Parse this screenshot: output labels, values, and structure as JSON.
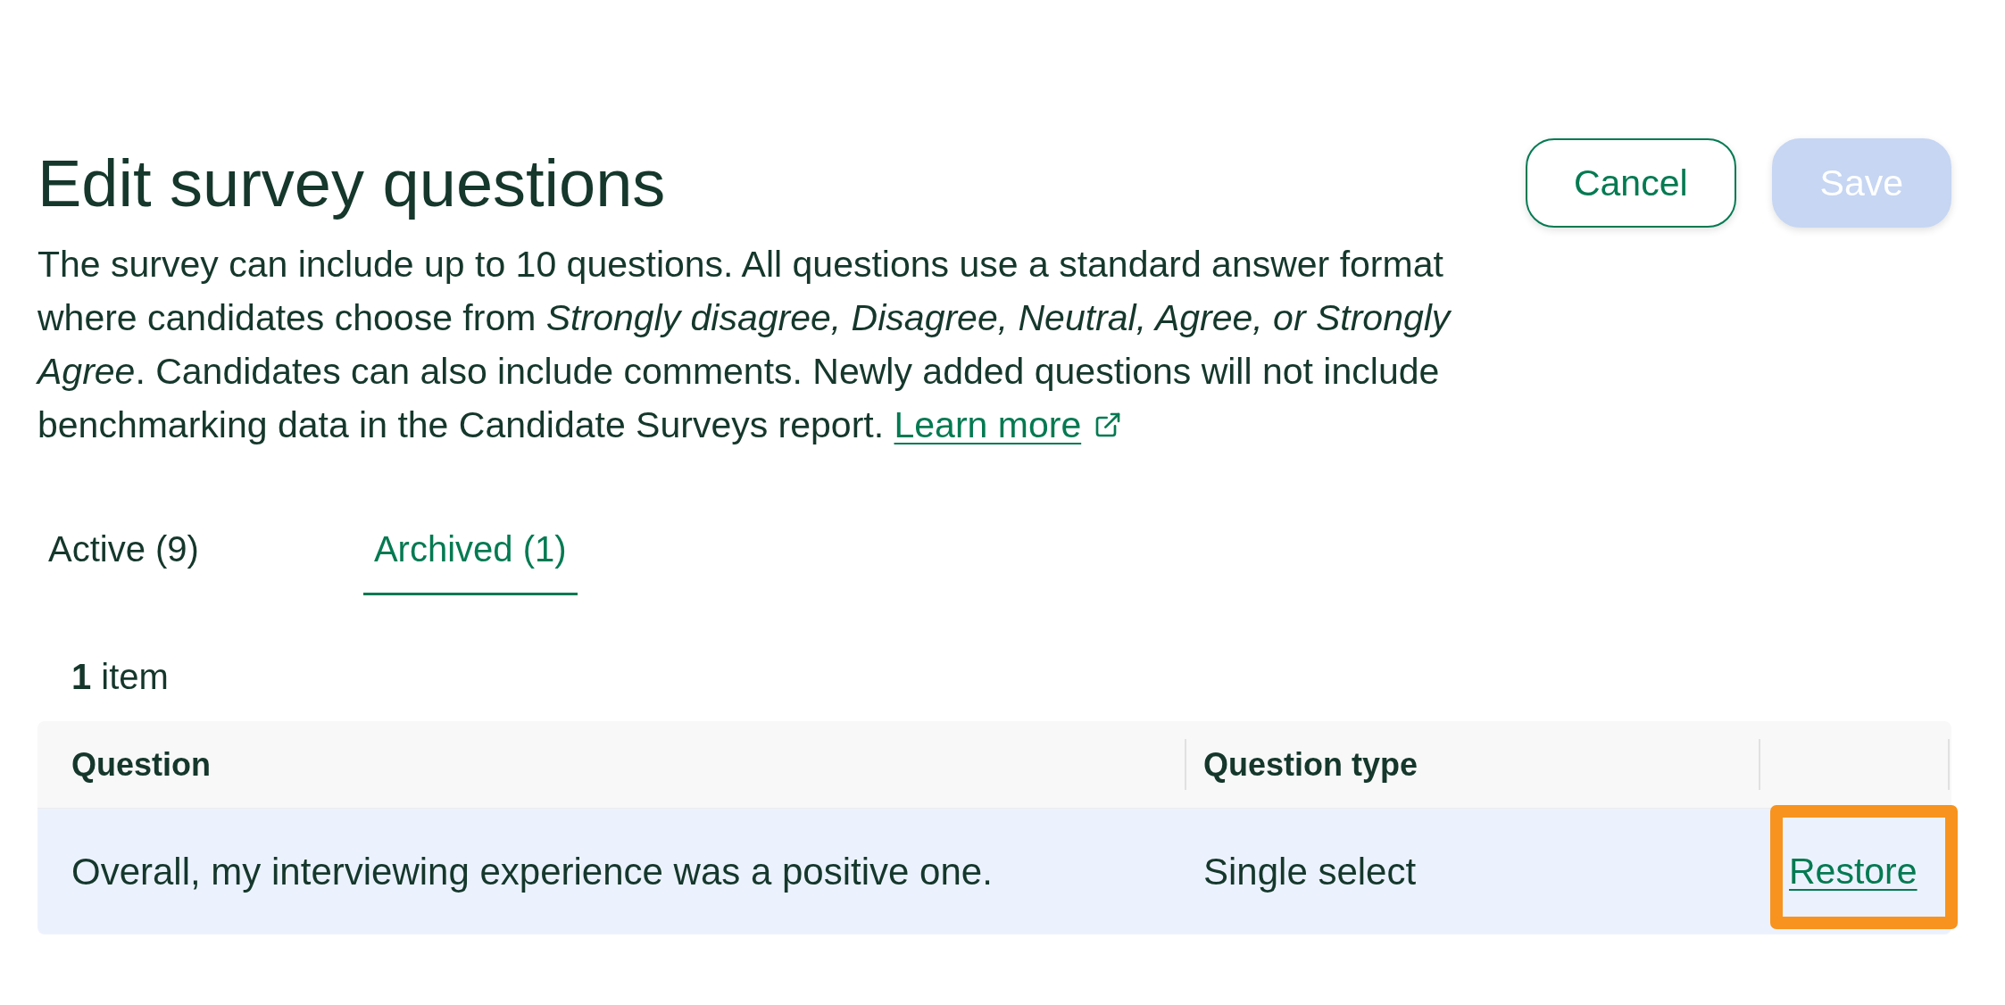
{
  "header": {
    "title": "Edit survey questions",
    "description": "The survey can include up to 10 questions. All questions use a standard answer format where candidates choose from *Strongly disagree, Disagree, Neutral, Agree, or Strongly Agree*. Candidates can also include comments. Newly added questions will not include benchmarking data in the Candidate Surveys report.",
    "link": {
      "label": "Learn more",
      "external": true
    }
  },
  "buttons": [
    {
      "label": "Cancel",
      "kind": "secondary",
      "disabled": false
    },
    {
      "label": "Save",
      "kind": "primary",
      "disabled": true
    }
  ],
  "tabs": [
    {
      "label": "Active (9)",
      "selected": false
    },
    {
      "label": "Archived (1)",
      "selected": true
    }
  ],
  "item_count": "**1** item",
  "table": {
    "columns": [
      "Question",
      "Question type"
    ],
    "rows": [
      {
        "question": "Overall, my interviewing experience was a positive one.",
        "question_type": "Single select",
        "highlighted": true,
        "action": {
          "label": "Restore",
          "outlined": true
        }
      }
    ]
  }
}
